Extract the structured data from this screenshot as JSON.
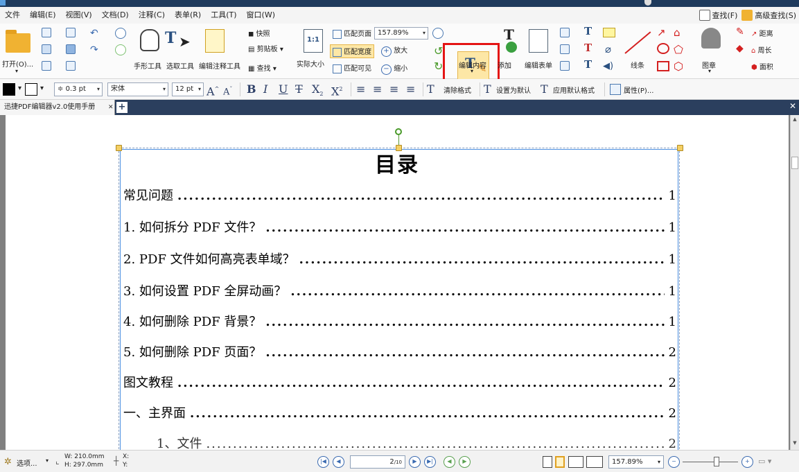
{
  "menu": {
    "items": [
      "文件",
      "编辑(E)",
      "视图(V)",
      "文档(D)",
      "注释(C)",
      "表单(R)",
      "工具(T)",
      "窗口(W)"
    ],
    "find_label": "查找(F)",
    "advanced_find_label": "高级查找(S)"
  },
  "ribbon": {
    "open_label": "打开(O)...",
    "hand_tool_label": "手形工具",
    "select_tool_label": "选取工具",
    "edit_annotation_label": "编辑注释工具",
    "snapshot_label": "快照",
    "clipboard_label": "剪贴板",
    "find_label": "查找",
    "actual_size_label": "实际大小",
    "actual_size_icon_text": "1:1",
    "fit_page_label": "匹配页面",
    "fit_width_label": "匹配宽度",
    "fit_visible_label": "匹配可见",
    "zoom_value": "157.89%",
    "zoom_in_label": "放大",
    "zoom_out_label": "缩小",
    "edit_content_label": "编辑内容",
    "add_label": "添加",
    "edit_form_label": "编辑表单",
    "lines_label": "线条",
    "stamp_label": "图章",
    "distance_label": "距离",
    "perimeter_label": "周长",
    "area_label": "面积"
  },
  "format": {
    "line_width": "0.3 pt",
    "font_name": "宋体",
    "font_size": "12 pt",
    "clear_format_label": "清除格式",
    "set_default_label": "设置为默认",
    "apply_default_label": "应用默认格式",
    "properties_label": "属性(P)..."
  },
  "tabs": [
    {
      "label": "迅捷PDF编辑器v2.0使用手册"
    }
  ],
  "document": {
    "title": "目录",
    "toc": [
      {
        "text": "常见问题",
        "page": "1"
      },
      {
        "text": "1.  如何拆分 PDF 文件？",
        "page": "1"
      },
      {
        "text": "2.  PDF 文件如何高亮表单域？",
        "page": "1"
      },
      {
        "text": "3.  如何设置 PDF 全屏动画？",
        "page": "1"
      },
      {
        "text": "4.  如何删除 PDF 背景？",
        "page": "1"
      },
      {
        "text": "5.  如何删除 PDF 页面？",
        "page": "2"
      },
      {
        "text": "图文教程",
        "page": "2"
      },
      {
        "text": "一、主界面",
        "page": "2"
      },
      {
        "text": "1、文件",
        "page": "2"
      }
    ]
  },
  "status": {
    "options_label": "选项...",
    "width": "W: 210.0mm",
    "height": "H: 297.0mm",
    "x_label": "X:",
    "y_label": "Y:",
    "current_page": "2",
    "total_pages": "/10",
    "zoom_value": "157.89%"
  },
  "colors": {
    "highlight": "#e41414",
    "accent": "#4a78b0",
    "tabbar": "#2b3f5e"
  }
}
